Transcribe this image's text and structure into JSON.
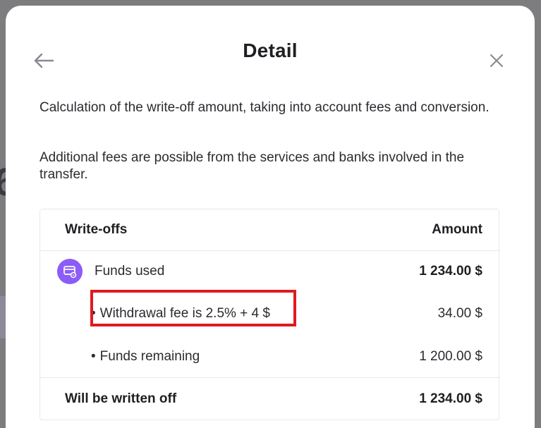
{
  "dialog": {
    "title": "Detail",
    "description_1": "Calculation of the write-off amount, taking into account fees and conversion.",
    "description_2": "Additional fees are possible from the services and banks involved in the transfer."
  },
  "table": {
    "header": {
      "left": "Write-offs",
      "right": "Amount"
    },
    "funds_used": {
      "label": "Funds used",
      "amount": "1 234.00 $"
    },
    "withdrawal_fee": {
      "label": "Withdrawal fee is 2.5% + 4 $",
      "amount": "34.00 $"
    },
    "funds_remaining": {
      "label": "Funds remaining",
      "amount": "1 200.00 $"
    },
    "total": {
      "label": "Will be written off",
      "amount": "1 234.00 $"
    }
  },
  "icons": {
    "back": "arrow-left-icon",
    "close": "close-icon",
    "funds": "wallet-card-icon"
  },
  "colors": {
    "accent": "#8b5cf6",
    "highlight": "#e0191f",
    "backdrop": "#7d7d80"
  }
}
